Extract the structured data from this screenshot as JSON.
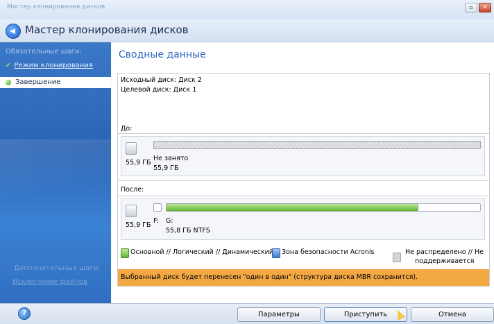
{
  "window": {
    "app_title": "Мастер клонирования дисков",
    "header_title": "Мастер клонирования дисков"
  },
  "sidebar": {
    "required_steps_label": "Обязательные шаги:",
    "step1_label": "Режим клонирования",
    "step2_label": "Завершение",
    "optional_steps_label": "Дополнительные шаги:",
    "exclude_files_label": "Исключение файлов"
  },
  "main": {
    "section_title": "Сводные данные",
    "source_disk": "Исходный диск: Диск 2",
    "target_disk": "Целевой диск: Диск 1",
    "before_label": "До:",
    "before": {
      "disk_size": "55,9 ГБ",
      "partition_name": "Не занято",
      "partition_size": "55,9 ГБ"
    },
    "after_label": "После:",
    "after": {
      "disk_size": "55,9 ГБ",
      "small_partition_label": "F:",
      "partition_name": "G:",
      "partition_info": "55,8 ГБ  NTFS",
      "fill_fraction": 0.8
    },
    "legend": {
      "primary": "Основной // Логический // Динамический",
      "acronis_zone": "Зона безопасности Acronis",
      "unallocated_line1": "Не распределено // Не",
      "unallocated_line2": "поддерживается"
    },
    "notice": "Выбранный диск будет перенесен \"один в один\" (структура диска MBR сохранится)."
  },
  "footer": {
    "params_button": "Параметры",
    "proceed_button": "Приступить",
    "cancel_button": "Отмена"
  },
  "colors": {
    "sidebar": "#2c64b4",
    "accent_title": "#2b67c0",
    "notice_bg": "#f3a844",
    "partition_green": "#5fb632"
  }
}
